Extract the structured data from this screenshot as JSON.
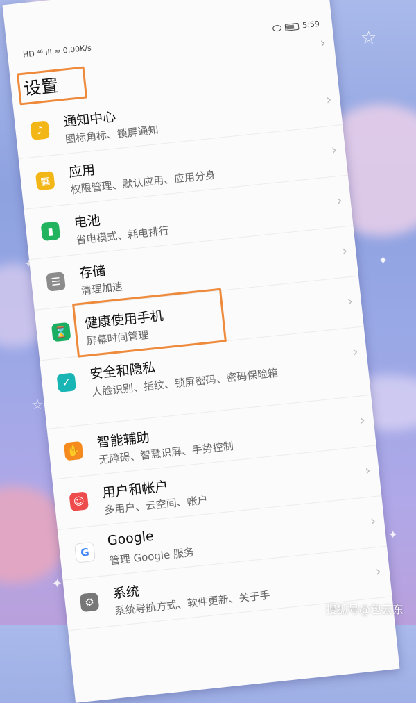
{
  "statusbar": {
    "left": "HD ⁴⁶ ıll ≈ 0.00K/s",
    "time": "5:59"
  },
  "header": {
    "title": "设置"
  },
  "items": [
    {
      "label": "通知中心",
      "sub": "图标角标、锁屏通知",
      "icon": "bell-icon",
      "color": "#f2b617"
    },
    {
      "label": "应用",
      "sub": "权限管理、默认应用、应用分身",
      "icon": "apps-grid-icon",
      "color": "#f2b617"
    },
    {
      "label": "电池",
      "sub": "省电模式、耗电排行",
      "icon": "battery-icon",
      "color": "#22b35e"
    },
    {
      "label": "存储",
      "sub": "清理加速",
      "icon": "storage-icon",
      "color": "#8c8c8c"
    },
    {
      "label": "健康使用手机",
      "sub": "屏幕时间管理",
      "icon": "hourglass-icon",
      "color": "#1aae62"
    },
    {
      "label": "安全和隐私",
      "sub": "人脸识别、指纹、锁屏密码、密码保险箱",
      "icon": "shield-check-icon",
      "color": "#19b5b5"
    },
    {
      "label": "智能辅助",
      "sub": "无障碍、智慧识屏、手势控制",
      "icon": "hand-icon",
      "color": "#f58a1f"
    },
    {
      "label": "用户和帐户",
      "sub": "多用户、云空间、帐户",
      "icon": "user-icon",
      "color": "#ee4c4c"
    },
    {
      "label": "Google",
      "sub": "管理 Google 服务",
      "icon": "google-icon",
      "color": "#ffffff"
    },
    {
      "label": "系统",
      "sub": "系统导航方式、软件更新、关于手",
      "icon": "system-icon",
      "color": "#777777"
    }
  ],
  "watermark": "搜狐号@包云东",
  "colors": {
    "highlight": "#ee8a3c",
    "background": "#fbfbfb"
  }
}
